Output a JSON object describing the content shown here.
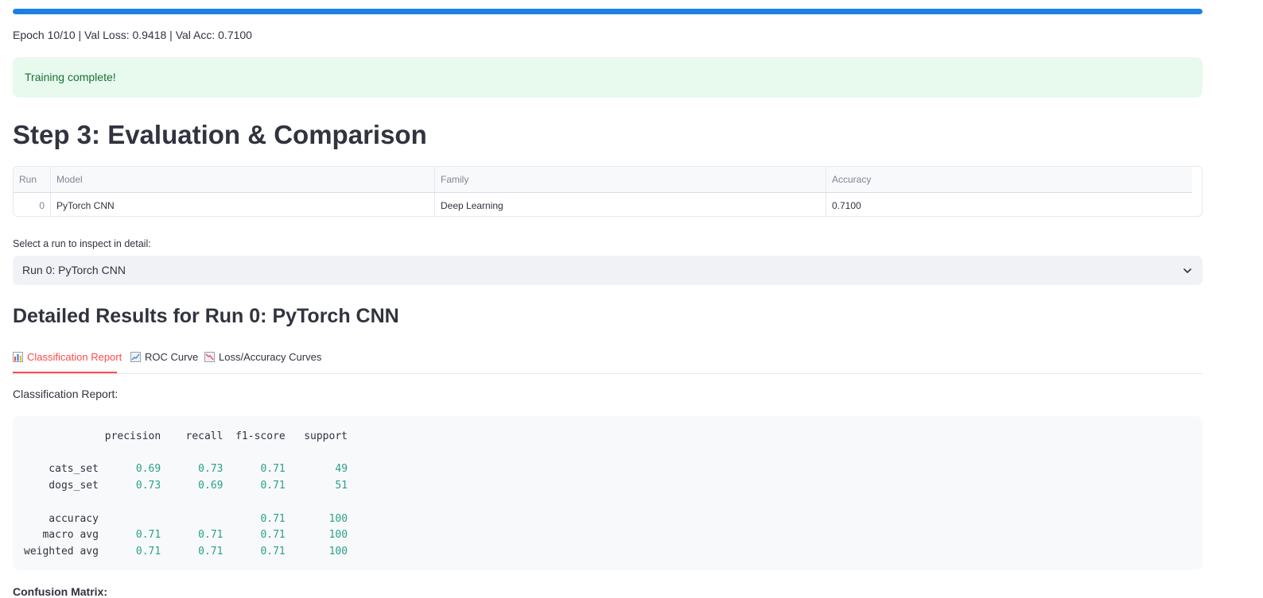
{
  "progress": {
    "fraction": 1.0,
    "color": "#1f7fe0"
  },
  "epoch_status": "Epoch 10/10 | Val Loss: 0.9418 | Val Acc: 0.7100",
  "alert": {
    "text": "Training complete!"
  },
  "section_title": "Step 3: Evaluation & Comparison",
  "results_table": {
    "columns": [
      "Run",
      "Model",
      "Family",
      "Accuracy"
    ],
    "rows": [
      {
        "run": "0",
        "model": "PyTorch CNN",
        "family": "Deep Learning",
        "accuracy": "0.7100"
      }
    ]
  },
  "run_select": {
    "label": "Select a run to inspect in detail:",
    "value": "Run 0: PyTorch CNN",
    "icon": "chevron-down-icon"
  },
  "detail_title": "Detailed Results for Run 0: PyTorch CNN",
  "tabs": [
    {
      "label": "Classification Report",
      "icon": "bar-chart-icon",
      "active": true
    },
    {
      "label": "ROC Curve",
      "icon": "line-chart-up-icon",
      "active": false
    },
    {
      "label": "Loss/Accuracy Curves",
      "icon": "line-chart-down-icon",
      "active": false
    }
  ],
  "classification_report": {
    "title": "Classification Report:",
    "headers": [
      "precision",
      "recall",
      "f1-score",
      "support"
    ],
    "rows": [
      {
        "label": "cats_set",
        "precision": "0.69",
        "recall": "0.73",
        "f1": "0.71",
        "support": "49"
      },
      {
        "label": "dogs_set",
        "precision": "0.73",
        "recall": "0.69",
        "f1": "0.71",
        "support": "51"
      },
      {
        "label": "accuracy",
        "precision": "",
        "recall": "",
        "f1": "0.71",
        "support": "100"
      },
      {
        "label": "macro avg",
        "precision": "0.71",
        "recall": "0.71",
        "f1": "0.71",
        "support": "100"
      },
      {
        "label": "weighted avg",
        "precision": "0.71",
        "recall": "0.71",
        "f1": "0.71",
        "support": "100"
      }
    ]
  },
  "next_heading_partial": "Confusion Matrix:",
  "colors": {
    "accent": "#ff4b4b",
    "success_bg": "#e8f9ee",
    "success_text": "#177233",
    "numeric": "#29a18a"
  }
}
